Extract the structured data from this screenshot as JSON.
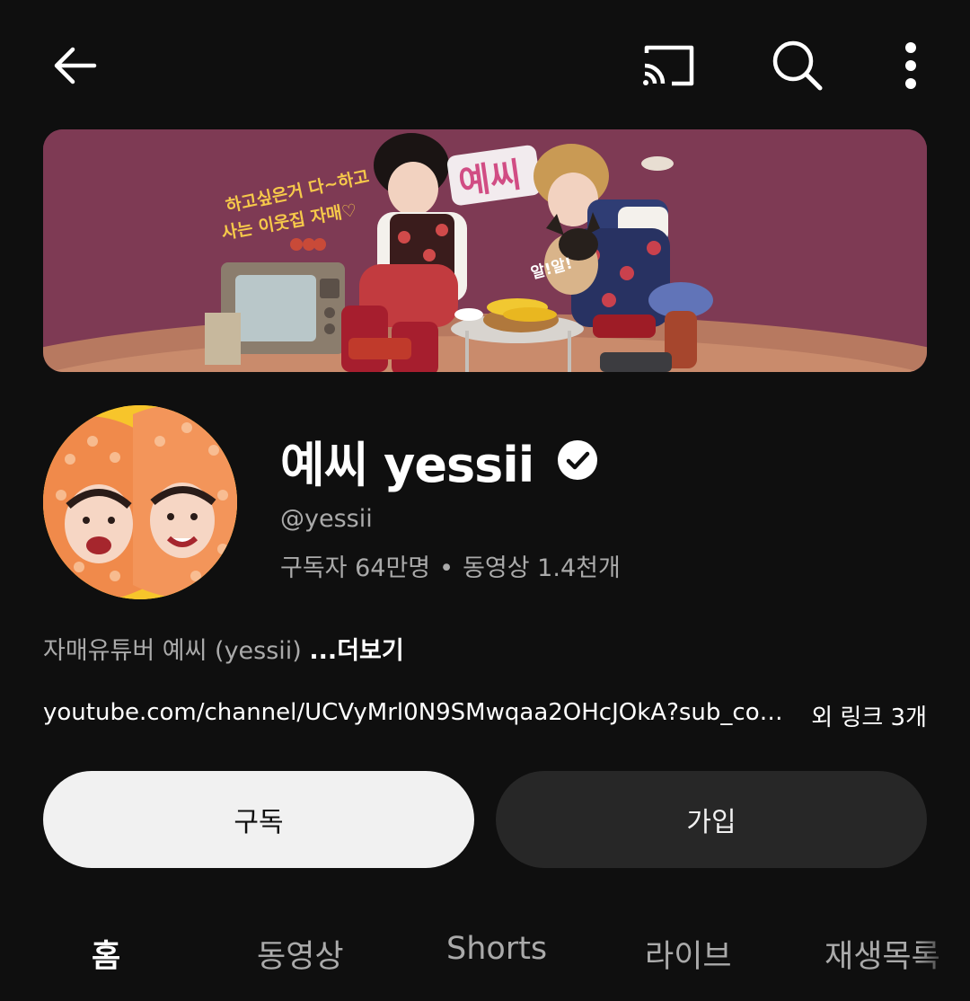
{
  "header": {
    "back_icon": "arrow-back-icon",
    "cast_icon": "cast-icon",
    "search_icon": "search-icon",
    "more_icon": "more-vert-icon"
  },
  "channel": {
    "name": "예씨 yessii",
    "handle": "@yessii",
    "subscribers": "구독자 64만명",
    "separator": "•",
    "videos": "동영상 1.4천개",
    "description": "자매유튜버 예씨 (yessii) ",
    "description_more": "...더보기",
    "link_url": "youtube.com/channel/UCVyMrl0N9SMwqaa2OHcJOkA?sub_co…",
    "link_more": "외 링크 3개",
    "verified_icon": "verified-check-icon"
  },
  "actions": {
    "subscribe_label": "구독",
    "join_label": "가입"
  },
  "tabs": [
    {
      "label": "홈",
      "active": true
    },
    {
      "label": "동영상",
      "active": false
    },
    {
      "label": "Shorts",
      "active": false
    },
    {
      "label": "라이브",
      "active": false
    },
    {
      "label": "재생목록",
      "active": false
    }
  ],
  "colors": {
    "background": "#0f0f0f",
    "banner_bg": "#7e3a54",
    "subscribe_bg": "#f1f1f1",
    "join_bg": "#272727",
    "secondary_text": "#aaaaaa",
    "avatar_bg": "#f7c52b"
  }
}
